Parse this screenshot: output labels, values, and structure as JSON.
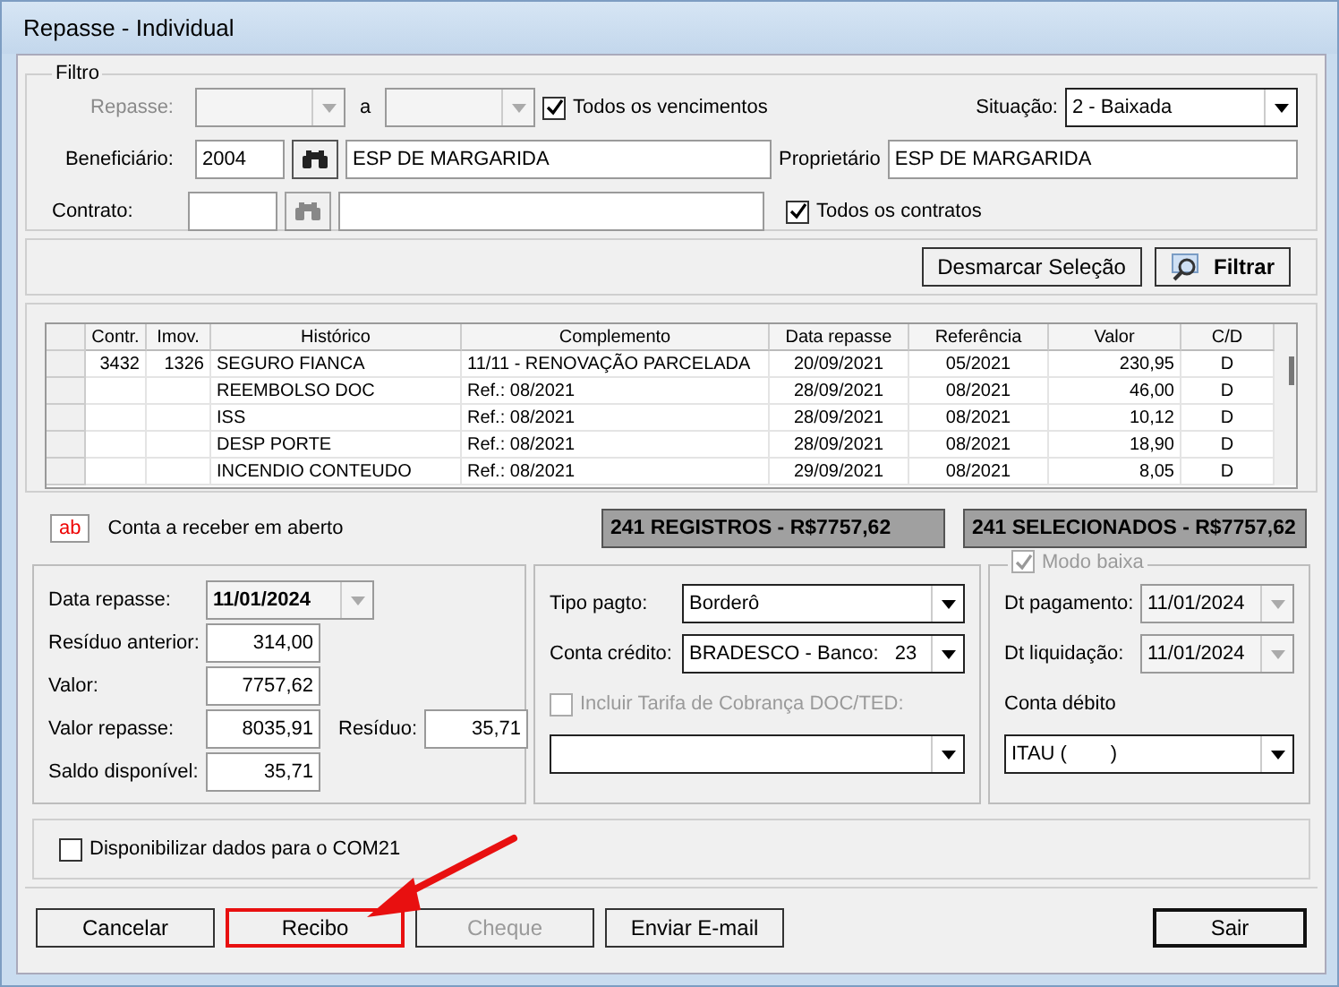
{
  "window": {
    "title": "Repasse - Individual"
  },
  "filter": {
    "legend": "Filtro",
    "repasse": {
      "label": "Repasse:",
      "disabled": true,
      "separator": "a"
    },
    "todos_vencimentos": {
      "label": "Todos os vencimentos",
      "checked": true
    },
    "situacao": {
      "label": "Situação:",
      "value": "2 - Baixada"
    },
    "beneficiario": {
      "label": "Beneficiário:",
      "code": "2004",
      "name": "ESP DE MARGARIDA"
    },
    "proprietario": {
      "label": "Proprietário",
      "value": "ESP DE MARGARIDA"
    },
    "contrato": {
      "label": "Contrato:"
    },
    "todos_contratos": {
      "label": "Todos os contratos",
      "checked": true
    }
  },
  "actions": [
    {
      "label": "Desmarcar Seleção",
      "kind": "plain"
    },
    {
      "label": "Filtrar",
      "kind": "search"
    }
  ],
  "table": {
    "columns": [
      "Contr.",
      "Imov.",
      "Histórico",
      "Complemento",
      "Data repasse",
      "Referência",
      "Valor",
      "C/D"
    ],
    "rows": [
      {
        "cells": [
          "3432",
          "1326",
          "SEGURO FIANCA",
          "11/11 - RENOVAÇÃO PARCELADA",
          "20/09/2021",
          "05/2021",
          "230,95",
          "D"
        ]
      },
      {
        "cells": [
          "",
          "",
          "REEMBOLSO DOC",
          "Ref.: 08/2021",
          "28/09/2021",
          "08/2021",
          "46,00",
          "D"
        ]
      },
      {
        "cells": [
          "",
          "",
          "ISS",
          "Ref.: 08/2021",
          "28/09/2021",
          "08/2021",
          "10,12",
          "D"
        ]
      },
      {
        "cells": [
          "",
          "",
          "DESP PORTE",
          "Ref.: 08/2021",
          "28/09/2021",
          "08/2021",
          "18,90",
          "D"
        ]
      },
      {
        "cells": [
          "",
          "",
          "INCENDIO CONTEUDO",
          "Ref.: 08/2021",
          "29/09/2021",
          "08/2021",
          "8,05",
          "D"
        ]
      }
    ]
  },
  "legend": {
    "badge": "ab",
    "label": "Conta a receber em aberto"
  },
  "totals": [
    "241 REGISTROS - R$7757,62",
    "241 SELECIONADOS - R$7757,62"
  ],
  "values": {
    "data_repasse": {
      "label": "Data repasse:",
      "value": "11/01/2024"
    },
    "residuo_anterior": {
      "label": "Resíduo anterior:",
      "value": "314,00"
    },
    "valor": {
      "label": "Valor:",
      "value": "7757,62"
    },
    "valor_repasse": {
      "label": "Valor repasse:",
      "value": "8035,91"
    },
    "residuo": {
      "label": "Resíduo:",
      "value": "35,71"
    },
    "saldo_disponivel": {
      "label": "Saldo disponível:",
      "value": "35,71"
    }
  },
  "payment": {
    "tipo_pagto": {
      "label": "Tipo pagto:",
      "value": "Borderô"
    },
    "conta_credito": {
      "label": "Conta crédito:",
      "value": "BRADESCO - Banco:   23"
    },
    "incluir_tarifa": {
      "label": "Incluir Tarifa de Cobrança DOC/TED:",
      "checked": false,
      "disabled": true
    }
  },
  "baixa": {
    "modo_baixa": {
      "label": "Modo baixa",
      "checked": true,
      "disabled": true
    },
    "dt_pagamento": {
      "label": "Dt pagamento:",
      "value": "11/01/2024"
    },
    "dt_liquidacao": {
      "label": "Dt liquidação:",
      "value": "11/01/2024"
    },
    "conta_debito": {
      "label": "Conta débito",
      "value": "ITAU (        )"
    }
  },
  "com21": {
    "label": "Disponibilizar dados para o COM21",
    "checked": false
  },
  "buttons": [
    {
      "label": "Cancelar",
      "disabled": false,
      "highlighted": false,
      "default": false
    },
    {
      "label": "Recibo",
      "disabled": false,
      "highlighted": true,
      "default": false
    },
    {
      "label": "Cheque",
      "disabled": true,
      "highlighted": false,
      "default": false
    },
    {
      "label": "Enviar E-mail",
      "disabled": false,
      "highlighted": false,
      "default": false
    },
    {
      "label": "Sair",
      "disabled": false,
      "highlighted": false,
      "default": true
    }
  ]
}
